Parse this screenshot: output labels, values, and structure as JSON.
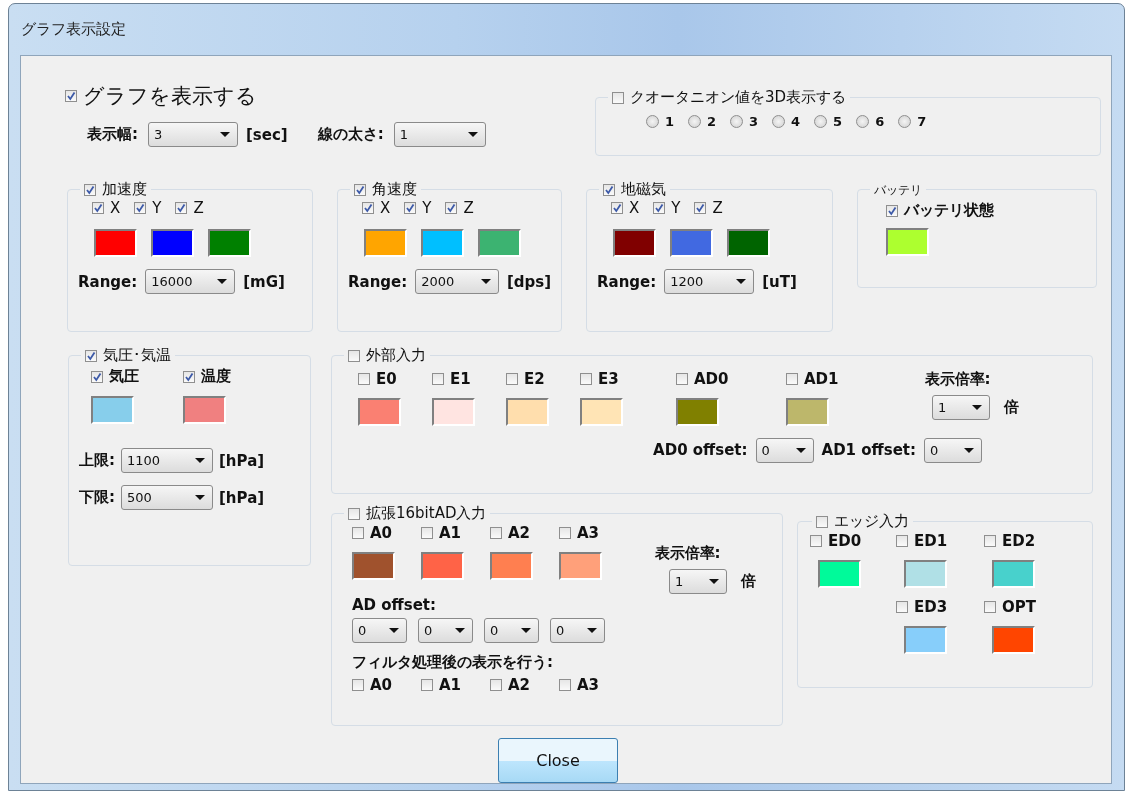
{
  "window": {
    "title": "グラフ表示設定"
  },
  "show_graph": {
    "label": "グラフを表示する",
    "checked": true
  },
  "display_width": {
    "label": "表示幅:",
    "value": "3",
    "unit": "[sec]"
  },
  "line_width": {
    "label": "線の太さ:",
    "value": "1"
  },
  "quaternion": {
    "label": "クオータニオン値を3D表示する",
    "checked": false,
    "options": [
      {
        "label": "1",
        "selected": false
      },
      {
        "label": "2",
        "selected": false
      },
      {
        "label": "3",
        "selected": false
      },
      {
        "label": "4",
        "selected": false
      },
      {
        "label": "5",
        "selected": false
      },
      {
        "label": "6",
        "selected": false
      },
      {
        "label": "7",
        "selected": false
      }
    ]
  },
  "sensors": [
    {
      "label": "加速度",
      "checked": true,
      "axes": [
        {
          "label": "X",
          "checked": true,
          "color": "#ff0000"
        },
        {
          "label": "Y",
          "checked": true,
          "color": "#0000ff"
        },
        {
          "label": "Z",
          "checked": true,
          "color": "#008000"
        }
      ],
      "range_label": "Range:",
      "range": "16000",
      "unit": "[mG]"
    },
    {
      "label": "角速度",
      "checked": true,
      "axes": [
        {
          "label": "X",
          "checked": true,
          "color": "#ffa500"
        },
        {
          "label": "Y",
          "checked": true,
          "color": "#00bfff"
        },
        {
          "label": "Z",
          "checked": true,
          "color": "#3cb371"
        }
      ],
      "range_label": "Range:",
      "range": "2000",
      "unit": "[dps]"
    },
    {
      "label": "地磁気",
      "checked": true,
      "axes": [
        {
          "label": "X",
          "checked": true,
          "color": "#800000"
        },
        {
          "label": "Y",
          "checked": true,
          "color": "#4169e1"
        },
        {
          "label": "Z",
          "checked": true,
          "color": "#006400"
        }
      ],
      "range_label": "Range:",
      "range": "1200",
      "unit": "[uT]"
    }
  ],
  "battery": {
    "title": "バッテリ",
    "label": "バッテリ状態",
    "checked": true,
    "color": "#adff2f"
  },
  "pressure": {
    "label": "気圧･気温",
    "checked": true,
    "channels": [
      {
        "label": "気圧",
        "checked": true,
        "color": "#87ceeb"
      },
      {
        "label": "温度",
        "checked": true,
        "color": "#f08080"
      }
    ],
    "limits": [
      {
        "label": "上限:",
        "value": "1100",
        "unit": "[hPa]"
      },
      {
        "label": "下限:",
        "value": "500",
        "unit": "[hPa]"
      }
    ]
  },
  "external": {
    "label": "外部入力",
    "checked": false,
    "channels": [
      {
        "label": "E0",
        "checked": false,
        "color": "#fa8072"
      },
      {
        "label": "E1",
        "checked": false,
        "color": "#ffe4e1"
      },
      {
        "label": "E2",
        "checked": false,
        "color": "#ffdead"
      },
      {
        "label": "E3",
        "checked": false,
        "color": "#ffe4b5"
      },
      {
        "label": "AD0",
        "checked": false,
        "color": "#808000"
      },
      {
        "label": "AD1",
        "checked": false,
        "color": "#bdb76b"
      }
    ],
    "scale_label": "表示倍率:",
    "scale": "1",
    "scale_unit": "倍",
    "offsets": [
      {
        "label": "AD0 offset:",
        "value": "0"
      },
      {
        "label": "AD1 offset:",
        "value": "0"
      }
    ]
  },
  "ad16": {
    "label": "拡張16bitAD入力",
    "checked": false,
    "channels": [
      {
        "label": "A0",
        "checked": false,
        "color": "#a0522d"
      },
      {
        "label": "A1",
        "checked": false,
        "color": "#ff6347"
      },
      {
        "label": "A2",
        "checked": false,
        "color": "#ff7f50"
      },
      {
        "label": "A3",
        "checked": false,
        "color": "#ffa07a"
      }
    ],
    "scale_label": "表示倍率:",
    "scale": "1",
    "scale_unit": "倍",
    "offset_label": "AD offset:",
    "offsets": [
      "0",
      "0",
      "0",
      "0"
    ],
    "filter_label": "フィルタ処理後の表示を行う:",
    "filters": [
      {
        "label": "A0",
        "checked": false
      },
      {
        "label": "A1",
        "checked": false
      },
      {
        "label": "A2",
        "checked": false
      },
      {
        "label": "A3",
        "checked": false
      }
    ]
  },
  "edge": {
    "label": "エッジ入力",
    "checked": false,
    "channels": [
      {
        "label": "ED0",
        "checked": false,
        "color": "#00fa9a"
      },
      {
        "label": "ED1",
        "checked": false,
        "color": "#b0e0e6"
      },
      {
        "label": "ED2",
        "checked": false,
        "color": "#48d1cc"
      },
      {
        "label": "ED3",
        "checked": false,
        "color": "#87cefa"
      },
      {
        "label": "OPT",
        "checked": false,
        "color": "#ff4500"
      }
    ]
  },
  "close_button": {
    "label": "Close"
  }
}
